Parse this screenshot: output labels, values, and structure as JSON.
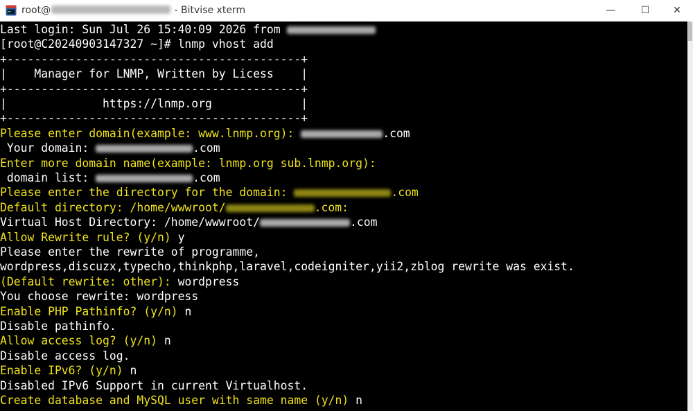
{
  "window": {
    "title_prefix": "root@",
    "title_suffix": " - Bitvise xterm",
    "minimize_glyph": "—",
    "maximize_glyph": "☐",
    "close_glyph": "✕"
  },
  "icons": {
    "app": "bitvise-xterm-icon"
  },
  "colors": {
    "terminal_bg": "#000000",
    "text_white": "#ffffff",
    "text_yellow": "#f0e21e"
  },
  "terminal": {
    "lines": [
      [
        {
          "t": "Last login: Sun Jul 26 15:40:09 2026 from ",
          "c": "w"
        },
        {
          "redact": 128,
          "c": "w"
        }
      ],
      [
        {
          "t": "[root@C20240903147327 ~]# lnmp vhost add",
          "c": "w"
        }
      ],
      [
        {
          "t": "+-------------------------------------------+",
          "c": "w"
        }
      ],
      [
        {
          "t": "|    Manager for LNMP, Written by Licess    |",
          "c": "w"
        }
      ],
      [
        {
          "t": "+-------------------------------------------+",
          "c": "w"
        }
      ],
      [
        {
          "t": "|              https://lnmp.org             |",
          "c": "w"
        }
      ],
      [
        {
          "t": "+-------------------------------------------+",
          "c": "w"
        }
      ],
      [
        {
          "t": "Please enter domain(example: www.lnmp.org): ",
          "c": "y"
        },
        {
          "redact": 118,
          "c": "w"
        },
        {
          "t": ".com",
          "c": "w"
        }
      ],
      [
        {
          "t": " Your domain: ",
          "c": "w"
        },
        {
          "redact": 140,
          "c": "w"
        },
        {
          "t": ".com",
          "c": "w"
        }
      ],
      [
        {
          "t": "Enter more domain name(example: lnmp.org sub.lnmp.org):",
          "c": "y"
        }
      ],
      [
        {
          "t": " domain list: ",
          "c": "w"
        },
        {
          "redact": 140,
          "c": "w"
        },
        {
          "t": ".com",
          "c": "w"
        }
      ],
      [
        {
          "t": "Please enter the directory for the domain: ",
          "c": "y"
        },
        {
          "redact": 140,
          "c": "y"
        },
        {
          "t": ".com",
          "c": "y"
        }
      ],
      [
        {
          "t": "Default directory: /home/wwwroot/",
          "c": "y"
        },
        {
          "redact": 128,
          "c": "y"
        },
        {
          "t": ".com:",
          "c": "y"
        }
      ],
      [
        {
          "t": "Virtual Host Directory: /home/wwwroot/",
          "c": "w"
        },
        {
          "redact": 130,
          "c": "w"
        },
        {
          "t": ".com",
          "c": "w"
        }
      ],
      [
        {
          "t": "Allow Rewrite rule? (y/n) ",
          "c": "y"
        },
        {
          "t": "y",
          "c": "w"
        }
      ],
      [
        {
          "t": "Please enter the rewrite of programme,",
          "c": "w"
        }
      ],
      [
        {
          "t": "wordpress,discuzx,typecho,thinkphp,laravel,codeigniter,yii2,zblog rewrite was exist.",
          "c": "w"
        }
      ],
      [
        {
          "t": "(Default rewrite: other): ",
          "c": "y"
        },
        {
          "t": "wordpress",
          "c": "w"
        }
      ],
      [
        {
          "t": "You choose rewrite: wordpress",
          "c": "w"
        }
      ],
      [
        {
          "t": "Enable PHP Pathinfo? (y/n) ",
          "c": "y"
        },
        {
          "t": "n",
          "c": "w"
        }
      ],
      [
        {
          "t": "Disable pathinfo.",
          "c": "w"
        }
      ],
      [
        {
          "t": "Allow access log? (y/n) ",
          "c": "y"
        },
        {
          "t": "n",
          "c": "w"
        }
      ],
      [
        {
          "t": "Disable access log.",
          "c": "w"
        }
      ],
      [
        {
          "t": "Enable IPv6? (y/n) ",
          "c": "y"
        },
        {
          "t": "n",
          "c": "w"
        }
      ],
      [
        {
          "t": "Disabled IPv6 Support in current Virtualhost.",
          "c": "w"
        }
      ],
      [
        {
          "t": "Create database and MySQL user with same name (y/n) ",
          "c": "y"
        },
        {
          "t": "n",
          "c": "w"
        }
      ]
    ]
  }
}
